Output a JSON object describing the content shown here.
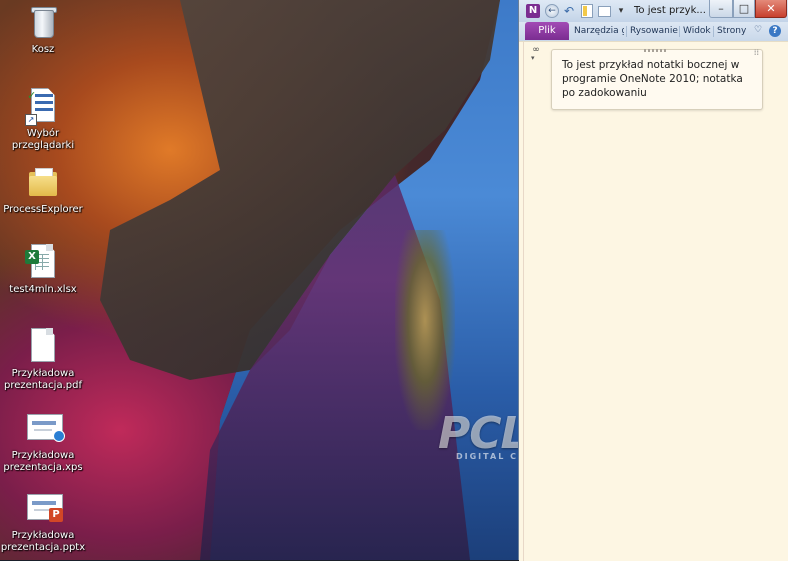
{
  "desktop": {
    "icons": [
      {
        "label": "Kosz"
      },
      {
        "label": "Wybór przeglądarki"
      },
      {
        "label": "ProcessExplorer"
      },
      {
        "label": "test4mln.xlsx"
      },
      {
        "label": "Przykładowa prezentacja.pdf"
      },
      {
        "label": "Przykładowa prezentacja.xps"
      },
      {
        "label": "Przykładowa prezentacja.pptx"
      }
    ],
    "watermark": {
      "brand": "PCLab.pl",
      "tagline": "DIGITAL COMMUNITY"
    }
  },
  "onenote": {
    "app_icon_letter": "N",
    "title": "To jest przyk...",
    "quick_access": {
      "back_glyph": "←",
      "undo_glyph": "↶",
      "more_glyph": "▾"
    },
    "window_controls": {
      "minimize": "–",
      "maximize": "□",
      "close": "✕"
    },
    "ribbon": {
      "file_tab": "Plik",
      "tabs": [
        "Narzędzia g",
        "Rysowanie",
        "Widok",
        "Strony"
      ],
      "collapse_glyph": "♡",
      "help_glyph": "?"
    },
    "note": {
      "text": "To jest przykład notatki bocznej w programie OneNote 2010; notatka po zadokowaniu"
    },
    "colors": {
      "file_tab": "#7b2d91",
      "canvas": "#fdf6e3",
      "accent": "#3a78c4"
    }
  }
}
